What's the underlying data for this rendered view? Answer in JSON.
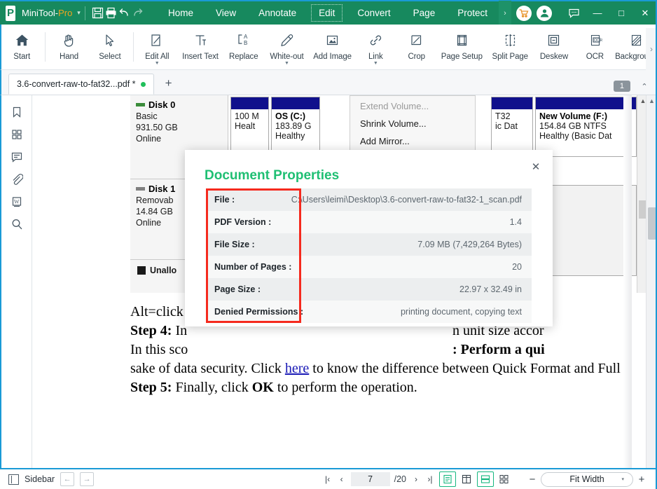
{
  "titlebar": {
    "brand_main": "MiniTool-",
    "brand_pro": "Pro",
    "logo_text": "P",
    "caret": "▾",
    "icons": [
      {
        "name": "save-icon",
        "glyph": "save"
      },
      {
        "name": "print-icon",
        "glyph": "print"
      },
      {
        "name": "undo-icon",
        "glyph": "↺"
      },
      {
        "name": "redo-icon",
        "glyph": "↻"
      }
    ],
    "tabs": [
      {
        "label": "Home",
        "active": false
      },
      {
        "label": "View",
        "active": false
      },
      {
        "label": "Annotate",
        "active": false
      },
      {
        "label": "Edit",
        "active": true
      },
      {
        "label": "Convert",
        "active": false
      },
      {
        "label": "Page",
        "active": false
      },
      {
        "label": "Protect",
        "active": false
      }
    ],
    "more_chevron": "›",
    "cart_icon": "cart-icon",
    "account_icon": "account-icon",
    "feedback_icon": "feedback-icon",
    "minimize": "—",
    "maximize": "□",
    "close": "✕"
  },
  "ribbon": {
    "items": [
      {
        "label": "Start",
        "icon": "home-icon",
        "caret": false
      },
      {
        "label": "Hand",
        "icon": "hand-icon",
        "caret": false
      },
      {
        "label": "Select",
        "icon": "cursor-icon",
        "caret": false
      },
      {
        "label": "Edit All",
        "icon": "edit-all-icon",
        "caret": true
      },
      {
        "label": "Insert Text",
        "icon": "insert-text-icon",
        "caret": false
      },
      {
        "label": "Replace",
        "icon": "replace-icon",
        "caret": false
      },
      {
        "label": "White-out",
        "icon": "white-out-icon",
        "caret": true
      },
      {
        "label": "Add Image",
        "icon": "add-image-icon",
        "caret": false
      },
      {
        "label": "Link",
        "icon": "link-icon",
        "caret": true
      },
      {
        "label": "Crop",
        "icon": "crop-icon",
        "caret": false
      },
      {
        "label": "Page Setup",
        "icon": "page-setup-icon",
        "caret": false
      },
      {
        "label": "Split Page",
        "icon": "split-page-icon",
        "caret": false
      },
      {
        "label": "Deskew",
        "icon": "deskew-icon",
        "caret": false
      },
      {
        "label": "OCR",
        "icon": "ocr-icon",
        "caret": false
      },
      {
        "label": "Background",
        "icon": "background-icon",
        "caret": true
      }
    ],
    "expand_chevron": "›"
  },
  "tabbar": {
    "doc_tab_label": "3.6-convert-raw-to-fat32...pdf *",
    "new_tab": "+",
    "count_badge": "1",
    "collapse_chevron": "⌃"
  },
  "sidebar": {
    "items": [
      {
        "name": "bookmark-icon",
        "label": "Bookmark"
      },
      {
        "name": "thumbnails-icon",
        "label": "Thumbnails"
      },
      {
        "name": "comment-icon",
        "label": "Comments"
      },
      {
        "name": "attachment-icon",
        "label": "Attachments"
      },
      {
        "name": "word-icon",
        "label": "Word"
      },
      {
        "name": "search-icon",
        "label": "Search"
      }
    ]
  },
  "dialog": {
    "title": "Document Properties",
    "close": "✕",
    "rows": [
      {
        "key": "File :",
        "value": "C:\\Users\\leimi\\Desktop\\3.6-convert-raw-to-fat32-1_scan.pdf"
      },
      {
        "key": "PDF Version :",
        "value": "1.4"
      },
      {
        "key": "File Size :",
        "value": "7.09 MB (7,429,264 Bytes)"
      },
      {
        "key": "Number of Pages :",
        "value": "20"
      },
      {
        "key": "Page Size :",
        "value": "22.97 x 32.49 in"
      },
      {
        "key": "Denied Permissions :",
        "value": "printing document, copying text"
      }
    ],
    "highlight_color": "#f52a1e",
    "title_color": "#1fbf73"
  },
  "disk_management": {
    "disks": [
      {
        "name": "Disk 0",
        "type": "Basic",
        "size": "931.50 GB",
        "status": "Online"
      },
      {
        "name": "Disk 1",
        "type": "Removab",
        "size": "14.84 GB",
        "status": "Online"
      }
    ],
    "legend": "Unallo",
    "volumes": [
      {
        "name": "",
        "line1": "100 M",
        "line2": "Healt"
      },
      {
        "name": "OS  (C:)",
        "line1": "183.89 G",
        "line2": "Healthy"
      },
      {
        "name": "",
        "line1": "T32",
        "line2": "ic Dat"
      },
      {
        "name": "New Volume  (F:)",
        "line1": "154.84 GB NTFS",
        "line2": "Healthy (Basic Dat"
      }
    ],
    "menu_items": [
      {
        "label": "Extend Volume...",
        "disabled": true
      },
      {
        "label": "Shrink Volume...",
        "disabled": false
      },
      {
        "label": "Add Mirror...",
        "disabled": false
      }
    ]
  },
  "pdf_body": {
    "lines": [
      "Alt=click",
      "Step 4: In",
      "In this sco",
      "n unit size accor",
      ": Perform a qui",
      "sake of data security. Click here to know the difference between Quick Format and Full F",
      "Step 5: Finally, click OK to perform the operation."
    ],
    "line_alt": "Alt=click",
    "line_step4_a": "Step 4: ",
    "line_step4_b": "In",
    "line_scenario": "In this sco",
    "line_right1": "n unit size accor",
    "line_right2": ": Perform a qui",
    "line_sake_a": "sake of data security. Click ",
    "line_sake_link": "here",
    "line_sake_b": " to know the difference between Quick Format and Full F",
    "line_step5_a": "Step 5: ",
    "line_step5_b": "Finally, click ",
    "line_step5_ok": "OK",
    "line_step5_c": " to perform the operation."
  },
  "statusbar": {
    "sidebar_label": "Sidebar",
    "nav_back": "←",
    "nav_forward": "→",
    "first_page": "|‹",
    "prev_page": "‹",
    "page_value": "7",
    "page_total": "/20",
    "next_page": "›",
    "last_page": "›|",
    "view_modes": [
      {
        "name": "single-page-view-icon",
        "active": true
      },
      {
        "name": "facing-page-view-icon",
        "active": false
      },
      {
        "name": "continuous-scroll-icon",
        "active": true
      },
      {
        "name": "tiled-view-icon",
        "active": false
      }
    ],
    "zoom_out": "−",
    "zoom_level": "Fit Width",
    "zoom_caret": "▾",
    "zoom_in": "+"
  },
  "colors": {
    "brand_green": "#17895E",
    "accent_blue": "#1a9ad6",
    "title_green": "#1fbf73",
    "highlight_red": "#f52a1e",
    "orange": "#f0a41e"
  }
}
